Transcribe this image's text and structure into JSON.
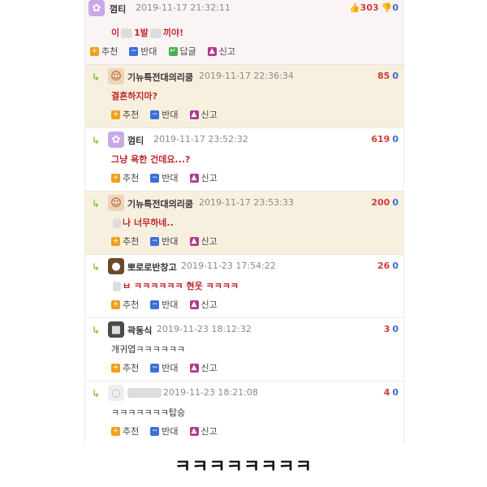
{
  "post": {
    "author": "껌티",
    "date": "2019-11-17 21:32:11",
    "up": "303",
    "down": "0",
    "body_a": "이",
    "body_b": "1발",
    "body_c": "끼야!",
    "actions": {
      "recommend": "추천",
      "oppose": "반대",
      "reply": "답글",
      "report": "신고"
    }
  },
  "comments": [
    {
      "author": "기뉴특전대의리쿰",
      "date": "2019-11-17 22:36:34",
      "up": "85",
      "down": "0",
      "text": "결혼하지마?"
    },
    {
      "author": "껌티",
      "date": "2019-11-17 23:52:32",
      "up": "619",
      "down": "0",
      "text": "그냥 욕한 건데요...?"
    },
    {
      "author": "기뉴특전대의리쿰",
      "date": "2019-11-17 23:53:33",
      "up": "200",
      "down": "0",
      "text": "나 너무하네.."
    },
    {
      "author": "뽀로로반창고",
      "date": "2019-11-23 17:54:22",
      "up": "26",
      "down": "0",
      "text": "ㅂ ㅋㅋㅋㅋㅋㅋ 현웃 ㅋㅋㅋㅋ"
    },
    {
      "author": "곽동식",
      "date": "2019-11-23 18:12:32",
      "up": "3",
      "down": "0",
      "text": "개귀엽ㅋㅋㅋㅋㅋㅋ"
    },
    {
      "author": "",
      "date": "2019-11-23 18:21:08",
      "up": "4",
      "down": "0",
      "text": "ㅋㅋㅋㅋㅋㅋㅋ탑승"
    }
  ],
  "caption": "ㅋㅋㅋㅋㅋㅋㅋㅋ"
}
